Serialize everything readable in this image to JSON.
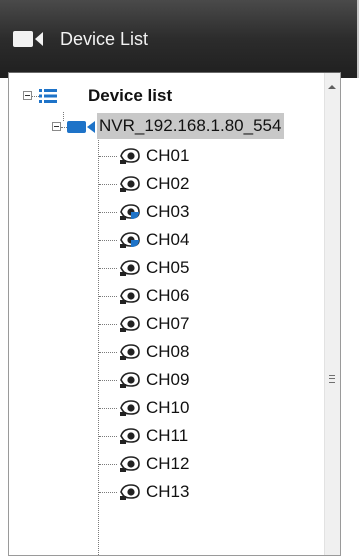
{
  "header": {
    "title": "Device List",
    "icon": "video-camera-icon"
  },
  "tree": {
    "root": {
      "label": "Device list",
      "icon": "list-icon",
      "expanded": true
    },
    "nvr": {
      "label": "NVR_192.168.1.80_554",
      "icon": "nvr-camera-icon",
      "expanded": true,
      "selected": true
    },
    "channels": [
      {
        "label": "CH01",
        "status": "offline"
      },
      {
        "label": "CH02",
        "status": "offline"
      },
      {
        "label": "CH03",
        "status": "online"
      },
      {
        "label": "CH04",
        "status": "online"
      },
      {
        "label": "CH05",
        "status": "offline"
      },
      {
        "label": "CH06",
        "status": "offline"
      },
      {
        "label": "CH07",
        "status": "offline"
      },
      {
        "label": "CH08",
        "status": "offline"
      },
      {
        "label": "CH09",
        "status": "offline"
      },
      {
        "label": "CH10",
        "status": "offline"
      },
      {
        "label": "CH11",
        "status": "offline"
      },
      {
        "label": "CH12",
        "status": "offline"
      },
      {
        "label": "CH13",
        "status": "offline"
      }
    ]
  },
  "colors": {
    "header_bg": "#2c2c2c",
    "accent_blue": "#1e73c8",
    "selection_bg": "#c8c8c8"
  }
}
